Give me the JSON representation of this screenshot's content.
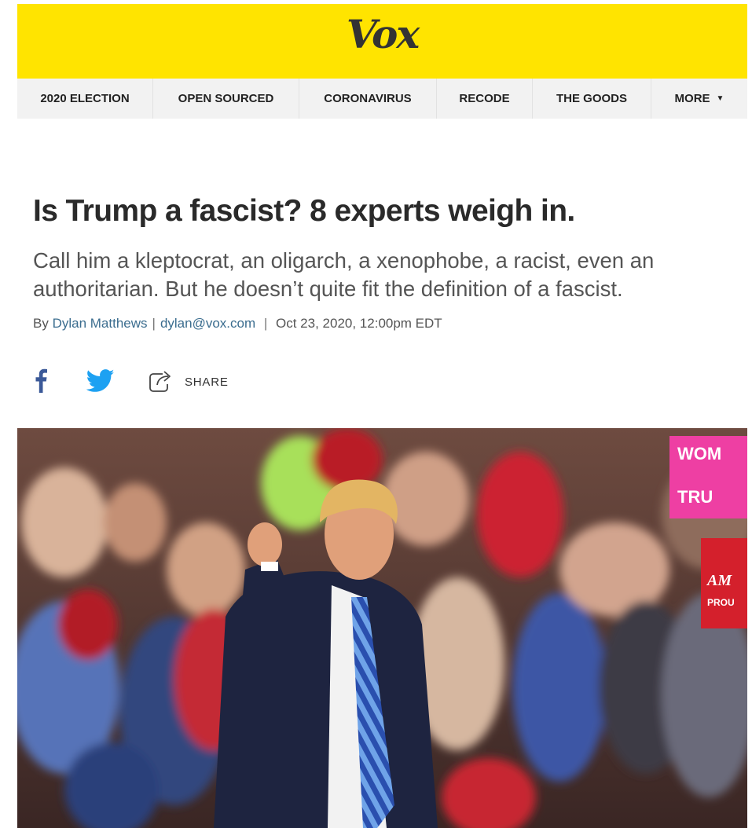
{
  "brand": {
    "logo_text": "Vox",
    "masthead_color": "#ffe400"
  },
  "nav": {
    "items": [
      {
        "label": "2020 ELECTION"
      },
      {
        "label": "OPEN SOURCED"
      },
      {
        "label": "CORONAVIRUS"
      },
      {
        "label": "RECODE"
      },
      {
        "label": "THE GOODS"
      },
      {
        "label": "MORE",
        "icon": "caret-down-icon"
      }
    ]
  },
  "article": {
    "headline": "Is Trump a fascist? 8 experts weigh in.",
    "dek": "Call him a kleptocrat, an oligarch, a xenophobe, a racist, even an authoritarian. But he doesn’t quite fit the definition of a fascist.",
    "byline": {
      "prefix": "By",
      "author": "Dylan Matthews",
      "email": "dylan@vox.com",
      "date": "Oct 23, 2020, 12:00pm EDT"
    }
  },
  "social": {
    "facebook_icon": "facebook-icon",
    "twitter_icon": "twitter-icon",
    "share_icon": "share-icon",
    "share_label": "SHARE"
  },
  "hero_image": {
    "subject": "photo of Donald Trump pointing at a rally crowd",
    "sign_top_text": "WOM FOR TRU",
    "sign_right_text": "AM PROU"
  },
  "colors": {
    "link": "#3b6d8f",
    "facebook": "#3b5998",
    "twitter": "#1da1f2",
    "headline": "#2a2a2a"
  }
}
